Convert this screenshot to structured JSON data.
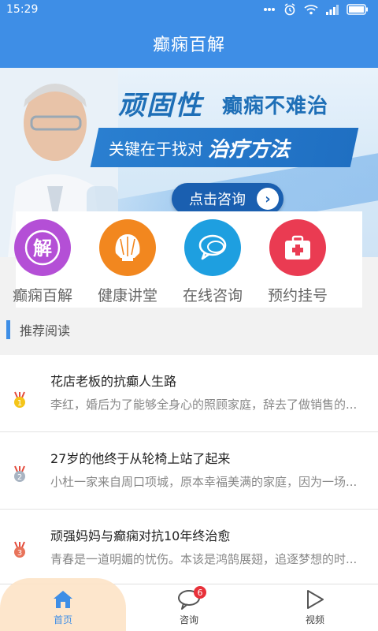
{
  "status_bar": {
    "time": "15:29",
    "battery_icon": "battery-icon",
    "wifi_icon": "wifi-icon",
    "signal_icon": "signal-icon",
    "alarm_icon": "alarm-icon"
  },
  "title_bar": {
    "title": "癫痫百解"
  },
  "banner": {
    "headline_a": "顽固性",
    "headline_b": "癫痫不难治",
    "slogan_a": "关键在于找对",
    "slogan_b": "治疗方法",
    "consult_button": "点击咨询"
  },
  "quick_menu": {
    "items": [
      {
        "label": "癫痫百解",
        "icon": "jie-character-icon",
        "color": "#b44fd6"
      },
      {
        "label": "健康讲堂",
        "icon": "shell-icon",
        "color": "#f2871f"
      },
      {
        "label": "在线咨询",
        "icon": "chat-bubble-icon",
        "color": "#1e9fe0"
      },
      {
        "label": "预约挂号",
        "icon": "first-aid-kit-icon",
        "color": "#ea3b52"
      }
    ]
  },
  "section": {
    "title": "推荐阅读"
  },
  "articles": [
    {
      "rank": "1",
      "title": "花店老板的抗癫人生路",
      "desc": "李红，婚后为了能够全身心的照顾家庭，辞去了做销售的...",
      "badge_color": "#f5c518"
    },
    {
      "rank": "2",
      "title": "27岁的他终于从轮椅上站了起来",
      "desc": "小杜一家来自周口项城，原本幸福美满的家庭，因为一场...",
      "badge_color": "#a8b4c2"
    },
    {
      "rank": "3",
      "title": "顽强妈妈与癫痫对抗10年终治愈",
      "desc": "青春是一道明媚的忧伤。本该是鸿鹄展翅，追逐梦想的时...",
      "badge_color": "#e8735a"
    }
  ],
  "bottom_nav": {
    "items": [
      {
        "label": "首页",
        "icon": "home-icon",
        "active": true
      },
      {
        "label": "咨询",
        "icon": "chat-icon",
        "badge": "6"
      },
      {
        "label": "视频",
        "icon": "play-icon"
      }
    ]
  }
}
